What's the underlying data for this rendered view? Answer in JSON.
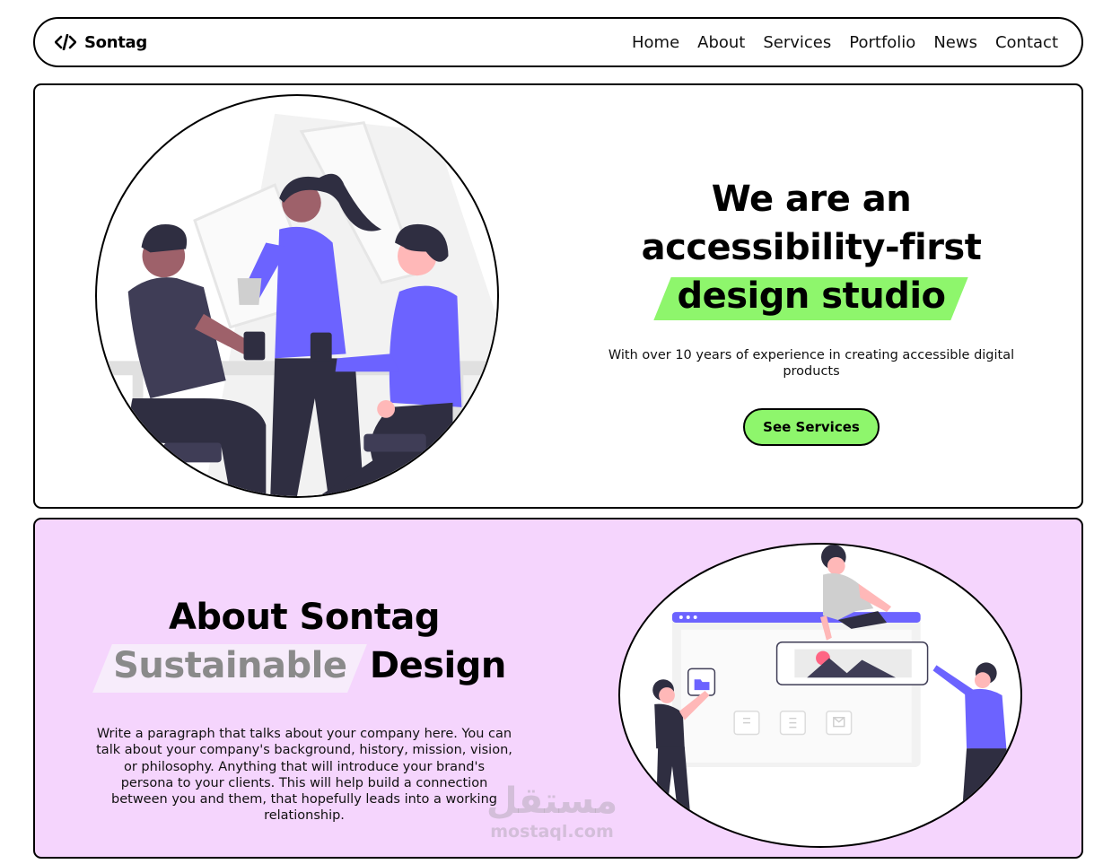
{
  "nav": {
    "brand": "Sontag",
    "brand_icon": "code-icon",
    "links": [
      "Home",
      "About",
      "Services",
      "Portfolio",
      "News",
      "Contact"
    ]
  },
  "hero": {
    "heading_line1": "We are an",
    "heading_line2": "accessibility-first",
    "heading_highlight": "design studio",
    "subtitle": "With over 10 years of experience in creating accessible digital products",
    "cta": "See Services",
    "illustration": "team-coffee-meeting-illustration"
  },
  "about": {
    "heading_line1": "About Sontag",
    "heading_highlight": "Sustainable",
    "heading_rest": "Design",
    "body": "Write a paragraph that talks about your company here. You can talk about your company's background, history, mission, vision, or philosophy. Anything that will introduce your brand's persona to your clients. This will help build a connection between you and them, that hopefully leads into a working relationship.",
    "illustration": "team-building-website-illustration"
  },
  "watermark": {
    "arabic": "مستقل",
    "latin": "mostaql.com"
  },
  "colors": {
    "accent_green": "#8ef66c",
    "about_bg": "#f5d5fd",
    "purple": "#6c63ff",
    "dark": "#2f2e41"
  }
}
